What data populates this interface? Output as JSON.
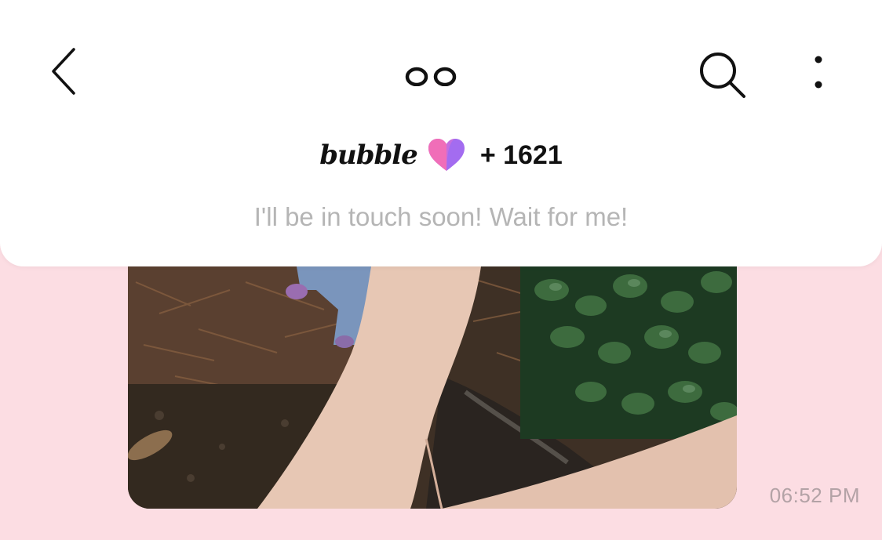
{
  "header": {
    "brand": "bubble",
    "follower_count": "+ 1621",
    "status_message": "I'll be in touch soon! Wait for me!"
  },
  "icons": {
    "back": "chevron-left-icon",
    "logo": "two-circles-logo",
    "brand_heart": "heart-icon",
    "search": "search-icon",
    "more": "more-vertical-icon"
  },
  "message": {
    "photo_description": "photo",
    "timestamp": "06:52 PM"
  },
  "colors": {
    "background": "#fcdde3",
    "header": "#ffffff",
    "heart_pink": "#f46fb4",
    "heart_purple": "#a36cf0",
    "status_text": "#b5b5b5",
    "timestamp_text": "#b3a2a6"
  }
}
